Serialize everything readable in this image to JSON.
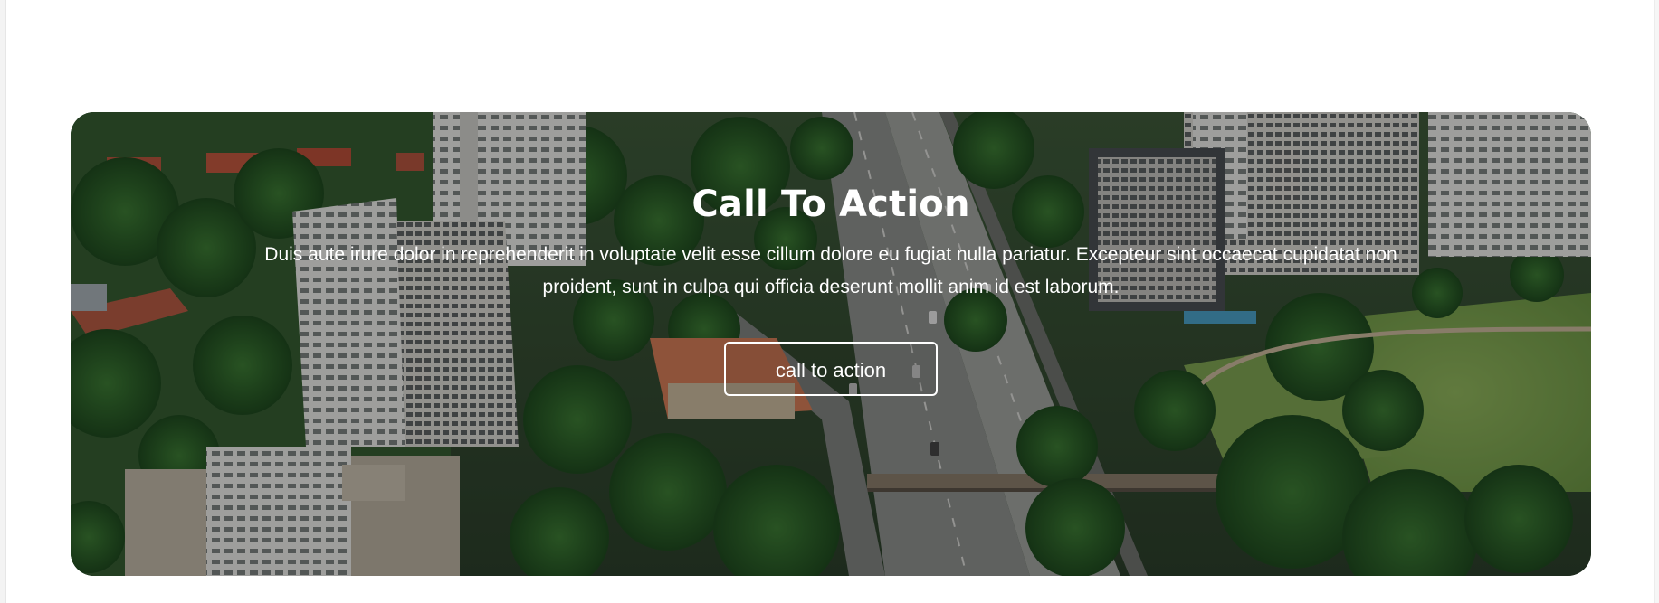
{
  "cta": {
    "title": "Call To Action",
    "description": "Duis aute irure dolor in reprehenderit in voluptate velit esse cillum dolore eu fugiat nulla pariatur. Excepteur sint occaecat cupidatat non proident, sunt in culpa qui officia deserunt mollit anim id est laborum.",
    "button_label": "call to action"
  },
  "colors": {
    "overlay": "#000000",
    "text": "#ffffff",
    "button_border": "#ffffff"
  }
}
